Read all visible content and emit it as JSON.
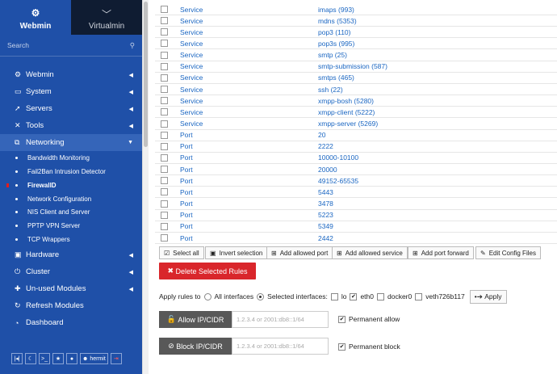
{
  "sidebar": {
    "tabs": [
      {
        "label": "Webmin",
        "icon": "webmin-gear-icon"
      },
      {
        "label": "Virtualmin",
        "icon": "chevron-down-icon"
      }
    ],
    "search_placeholder": "Search",
    "menu": [
      {
        "label": "Webmin"
      },
      {
        "label": "System"
      },
      {
        "label": "Servers"
      },
      {
        "label": "Tools"
      },
      {
        "label": "Networking"
      }
    ],
    "submenu": [
      "Bandwidth Monitoring",
      "Fail2Ban Intrusion Detector",
      "FirewallD",
      "Network Configuration",
      "NIS Client and Server",
      "PPTP VPN Server",
      "TCP Wrappers"
    ],
    "menu2": [
      {
        "label": "Hardware"
      },
      {
        "label": "Cluster"
      },
      {
        "label": "Un-used Modules"
      },
      {
        "label": "Refresh Modules"
      },
      {
        "label": "Dashboard"
      }
    ],
    "footer_user": "hermit"
  },
  "rules": [
    {
      "type": "Service",
      "name": "imaps (993)"
    },
    {
      "type": "Service",
      "name": "mdns (5353)"
    },
    {
      "type": "Service",
      "name": "pop3 (110)"
    },
    {
      "type": "Service",
      "name": "pop3s (995)"
    },
    {
      "type": "Service",
      "name": "smtp (25)"
    },
    {
      "type": "Service",
      "name": "smtp-submission (587)"
    },
    {
      "type": "Service",
      "name": "smtps (465)"
    },
    {
      "type": "Service",
      "name": "ssh (22)"
    },
    {
      "type": "Service",
      "name": "xmpp-bosh (5280)"
    },
    {
      "type": "Service",
      "name": "xmpp-client (5222)"
    },
    {
      "type": "Service",
      "name": "xmpp-server (5269)"
    },
    {
      "type": "Port",
      "name": "20"
    },
    {
      "type": "Port",
      "name": "2222"
    },
    {
      "type": "Port",
      "name": "10000-10100"
    },
    {
      "type": "Port",
      "name": "20000"
    },
    {
      "type": "Port",
      "name": "49152-65535"
    },
    {
      "type": "Port",
      "name": "5443"
    },
    {
      "type": "Port",
      "name": "3478"
    },
    {
      "type": "Port",
      "name": "5223"
    },
    {
      "type": "Port",
      "name": "5349"
    },
    {
      "type": "Port",
      "name": "2442"
    }
  ],
  "toolbar": {
    "select_all": "Select all",
    "invert": "Invert selection",
    "add_port": "Add allowed port",
    "add_service": "Add allowed service",
    "add_forward": "Add port forward",
    "edit_config": "Edit Config Files"
  },
  "delete_label": "Delete Selected Rules",
  "apply": {
    "prefix": "Apply rules to",
    "all": "All interfaces",
    "selected": "Selected interfaces:",
    "ifaces": [
      "lo",
      "eth0",
      "docker0",
      "veth726b117"
    ],
    "checked": [
      false,
      true,
      false,
      false
    ],
    "button": "Apply"
  },
  "allow": {
    "button": "Allow IP/CIDR",
    "placeholder": "1.2.3.4 or 2001:db8::1/64",
    "perm": "Permanent allow"
  },
  "block": {
    "button": "Block IP/CIDR",
    "placeholder": "1.2.3.4 or 2001:db8::1/64",
    "perm": "Permanent block"
  },
  "colors": {
    "sidebar": "#1f50a8",
    "danger": "#d9262b",
    "link": "#1a66c2"
  }
}
